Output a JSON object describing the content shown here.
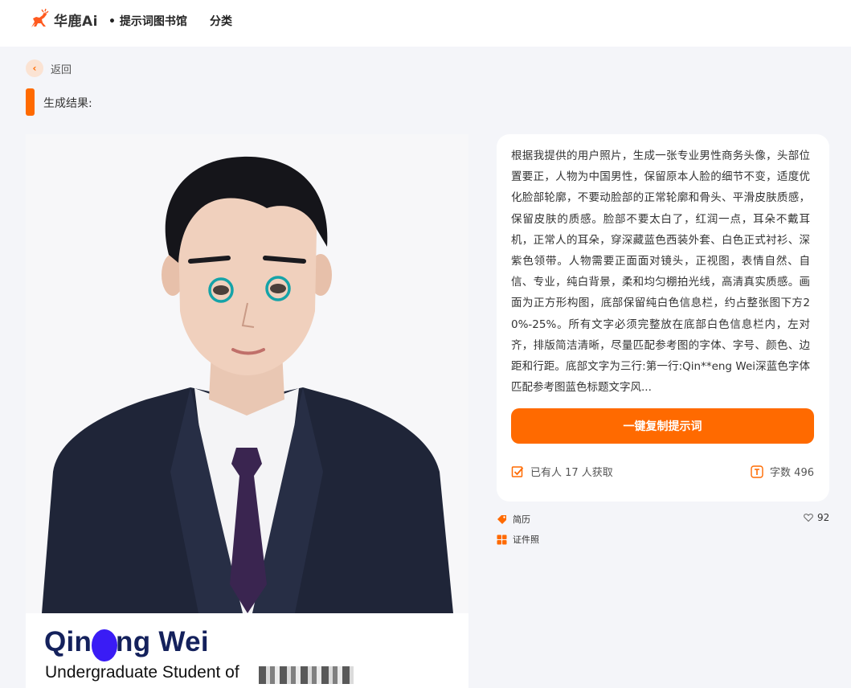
{
  "header": {
    "brand": "华鹿Ai",
    "nav_library": "• 提示词图书馆",
    "nav_category": "分类"
  },
  "back": {
    "icon": "chevron-left-icon",
    "label": "返回"
  },
  "section": {
    "title": "生成结果:"
  },
  "result_image": {
    "caption_name": "Qin   eng Wei",
    "caption_subtitle": "Undergraduate Student of"
  },
  "prompt": {
    "text": "根据我提供的用户照片，生成一张专业男性商务头像，头部位置要正，人物为中国男性，保留原本人脸的细节不变，适度优化脸部轮廓，不要动脸部的正常轮廓和骨头、平滑皮肤质感，保留皮肤的质感。脸部不要太白了，红润一点，耳朵不戴耳机，正常人的耳朵，穿深藏蓝色西装外套、白色正式衬衫、深紫色领带。人物需要正面面对镜头，正视图，表情自然、自信、专业，纯白背景，柔和均匀棚拍光线，高清真实质感。画面为正方形构图，底部保留纯白色信息栏，约占整张图下方20%-25%。所有文字必须完整放在底部白色信息栏内，左对齐，排版简洁清晰，尽量匹配参考图的字体、字号、颜色、边距和行距。底部文字为三行:第一行:Qin**eng Wei深蓝色字体匹配参考图蓝色标题文字风...",
    "copy_button": "一键复制提示词",
    "obtained_label": "已有人 17 人获取",
    "word_count_label": "字数 496"
  },
  "tags": [
    {
      "icon": "tag-icon",
      "label": "简历"
    },
    {
      "icon": "grid-icon",
      "label": "证件照"
    }
  ],
  "likes": {
    "icon": "heart-icon",
    "count": "92"
  },
  "colors": {
    "accent": "#ff6a00",
    "background": "#f4f5f9",
    "name_color": "#14215c"
  }
}
